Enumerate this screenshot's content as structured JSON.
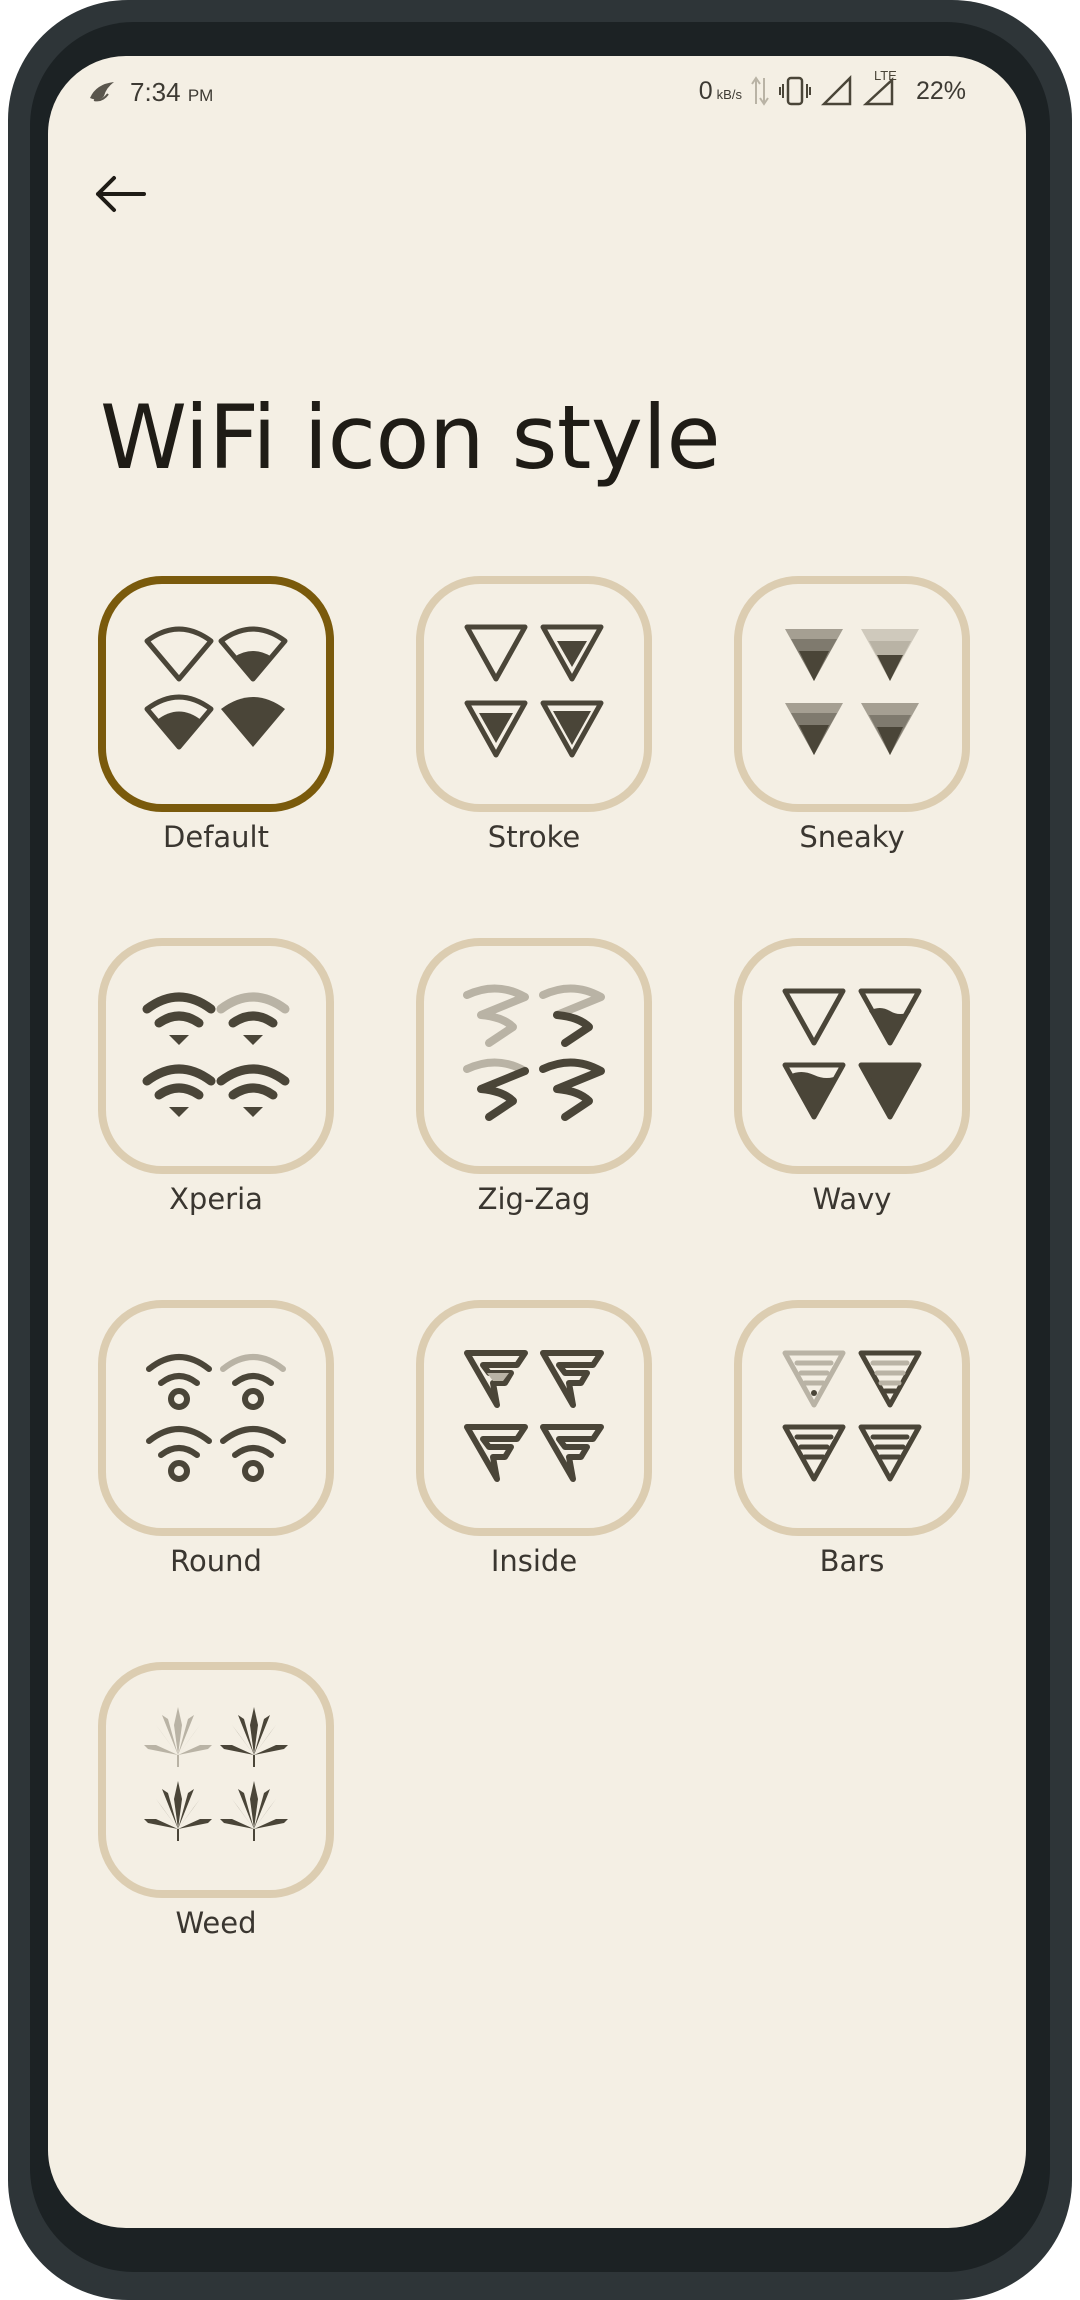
{
  "status_bar": {
    "time": "7:34",
    "ampm": "PM",
    "net_speed": "0",
    "net_unit": "kB/s",
    "network_label": "LTE",
    "battery": "22%"
  },
  "header": {
    "back_icon": "arrow-left-icon",
    "title": "WiFi icon style"
  },
  "styles": [
    {
      "label": "Default",
      "selected": true
    },
    {
      "label": "Stroke",
      "selected": false
    },
    {
      "label": "Sneaky",
      "selected": false
    },
    {
      "label": "Xperia",
      "selected": false
    },
    {
      "label": "Zig-Zag",
      "selected": false
    },
    {
      "label": "Wavy",
      "selected": false
    },
    {
      "label": "Round",
      "selected": false
    },
    {
      "label": "Inside",
      "selected": false
    },
    {
      "label": "Bars",
      "selected": false
    },
    {
      "label": "Weed",
      "selected": false
    }
  ],
  "colors": {
    "background": "#f4efe4",
    "tile_border": "#dccdb1",
    "selected_border": "#7a5a0c",
    "icon_dark": "#4a4538",
    "icon_light": "#b9b3a5"
  }
}
